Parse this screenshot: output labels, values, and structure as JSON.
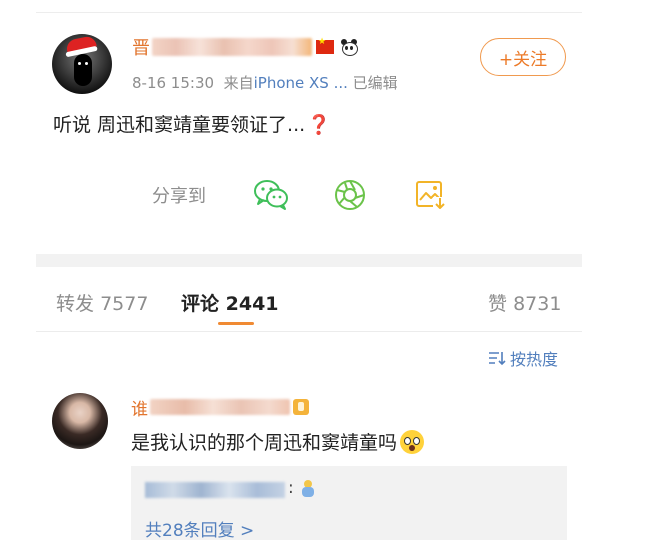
{
  "post": {
    "username_visible_char": "晋",
    "timestamp": "8-16 15:30",
    "source_prefix": "来自",
    "device": "iPhone XS ...",
    "edited": "已编辑",
    "follow_label": "+关注",
    "text": "听说 周迅和窦靖童要领证了...",
    "text_emoji": "❓"
  },
  "share": {
    "label": "分享到",
    "icons": [
      "wechat-icon",
      "moments-icon",
      "save-image-icon"
    ]
  },
  "tabs": [
    {
      "label": "转发",
      "count": "7577"
    },
    {
      "label": "评论",
      "count": "2441"
    },
    {
      "label": "赞",
      "count": "8731"
    }
  ],
  "sort_label": "按热度",
  "comment": {
    "username_visible_char": "谁",
    "text": "是我认识的那个周迅和窦靖童吗",
    "reply_colon": ":",
    "more_replies": "共28条回复 >"
  },
  "colors": {
    "accent_orange": "#ec7a28",
    "link_blue": "#527fbd",
    "muted_gray": "#8d8d8d",
    "text_dark": "#222222",
    "wechat_green": "#3fbf5a",
    "moments_green": "#6bc34a",
    "save_yellow": "#f2b428"
  }
}
